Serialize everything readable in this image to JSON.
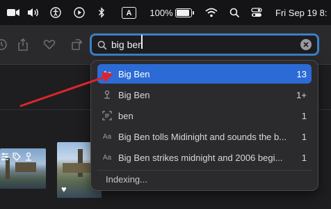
{
  "menubar": {
    "battery_text": "100%",
    "keyboard_badge": "A",
    "datetime": "Fri Sep 19 8:",
    "battery_level": 1.0
  },
  "search": {
    "query": "big ben",
    "placeholder": "Search"
  },
  "suggestions": [
    {
      "icon": "text-icon",
      "icon_glyph": "Aa",
      "label": "Big Ben",
      "count": "13",
      "selected": true
    },
    {
      "icon": "location-pin-icon",
      "icon_glyph": "",
      "label": "Big Ben",
      "count": "1+",
      "selected": false
    },
    {
      "icon": "scan-text-icon",
      "icon_glyph": "",
      "label": "ben",
      "count": "1",
      "selected": false
    },
    {
      "icon": "text-icon",
      "icon_glyph": "Aa",
      "label": "Big Ben tolls Midinight and sounds the b...",
      "count": "1",
      "selected": false
    },
    {
      "icon": "text-icon",
      "icon_glyph": "Aa",
      "label": "Big Ben strikes midnight and 2006 begi...",
      "count": "1",
      "selected": false
    }
  ],
  "indexing_text": "Indexing...",
  "colors": {
    "accent": "#2c6bd6",
    "focus_ring": "#3f7ec4",
    "annotation_arrow": "#e0242a"
  }
}
